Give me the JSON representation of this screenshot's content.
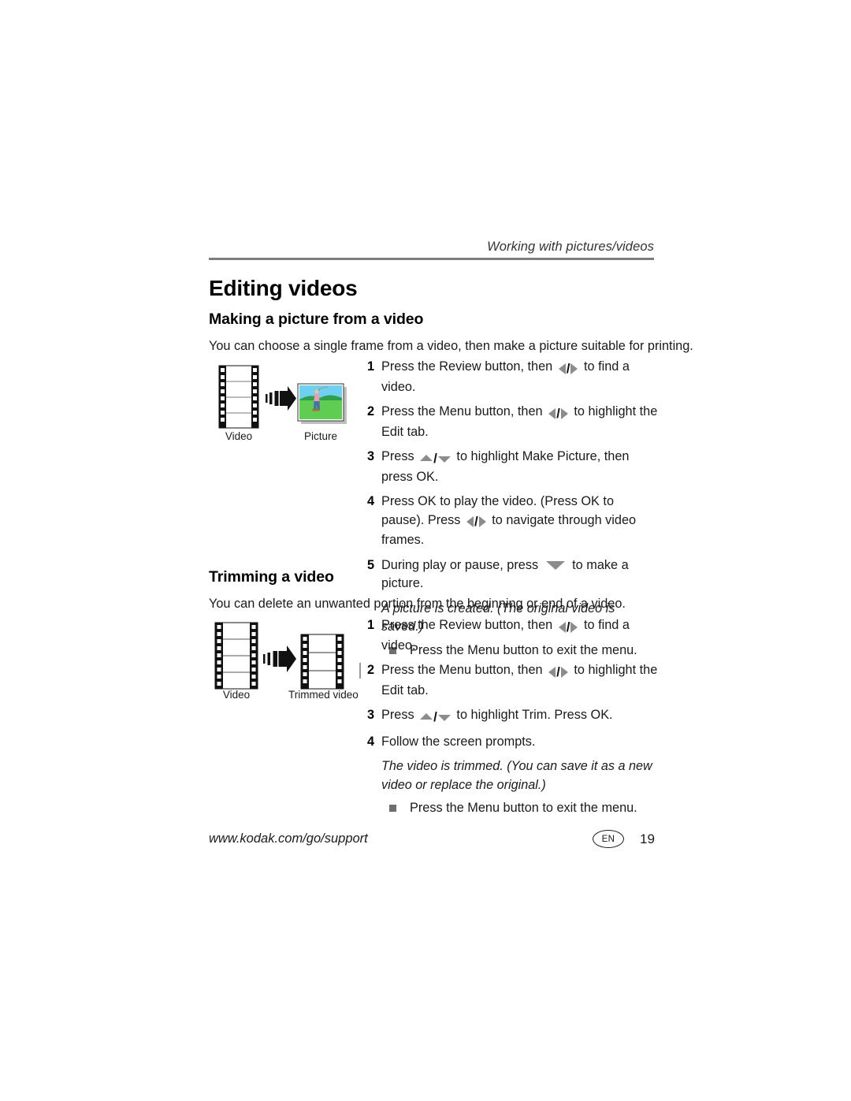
{
  "header": {
    "running_head": "Working with pictures/videos"
  },
  "headings": {
    "h1": "Editing videos",
    "section1": "Making a picture from a video",
    "section2": "Trimming a video"
  },
  "intro": {
    "section1": "You can choose a single frame from a video, then make a picture suitable for printing.",
    "section2": "You can delete an unwanted portion from the beginning or end of a video."
  },
  "section1_steps": [
    {
      "num": "1",
      "parts": [
        {
          "t": "text",
          "v": "Press the Review button, then "
        },
        {
          "t": "icon",
          "v": "left-right-arrows-icon"
        },
        {
          "t": "text",
          "v": " to find a video."
        }
      ]
    },
    {
      "num": "2",
      "parts": [
        {
          "t": "text",
          "v": "Press the Menu button, then "
        },
        {
          "t": "icon",
          "v": "left-right-arrows-icon"
        },
        {
          "t": "text",
          "v": " to highlight the Edit tab."
        }
      ]
    },
    {
      "num": "3",
      "parts": [
        {
          "t": "text",
          "v": "Press "
        },
        {
          "t": "icon",
          "v": "up-down-arrows-icon"
        },
        {
          "t": "text",
          "v": " to highlight Make Picture, then press OK."
        }
      ]
    },
    {
      "num": "4",
      "parts": [
        {
          "t": "text",
          "v": "Press OK to play the video. (Press OK to pause). Press "
        },
        {
          "t": "icon",
          "v": "left-right-arrows-icon"
        },
        {
          "t": "text",
          "v": " to navigate through video frames."
        }
      ]
    },
    {
      "num": "5",
      "parts": [
        {
          "t": "text",
          "v": "During play or pause, press "
        },
        {
          "t": "icon",
          "v": "down-arrow-icon"
        },
        {
          "t": "text",
          "v": " to make a picture."
        }
      ]
    }
  ],
  "section1_note": "A picture is created. (The original video is saved.)",
  "section1_bullet": "Press the Menu button to exit the menu.",
  "section2_steps": [
    {
      "num": "1",
      "parts": [
        {
          "t": "text",
          "v": "Press the Review button, then "
        },
        {
          "t": "icon",
          "v": "left-right-arrows-icon"
        },
        {
          "t": "text",
          "v": " to find a video."
        }
      ]
    },
    {
      "num": "2",
      "parts": [
        {
          "t": "text",
          "v": "Press the Menu button, then "
        },
        {
          "t": "icon",
          "v": "left-right-arrows-icon"
        },
        {
          "t": "text",
          "v": " to highlight the Edit tab."
        }
      ]
    },
    {
      "num": "3",
      "parts": [
        {
          "t": "text",
          "v": "Press "
        },
        {
          "t": "icon",
          "v": "up-down-arrows-icon"
        },
        {
          "t": "text",
          "v": " to highlight Trim. Press OK."
        }
      ]
    },
    {
      "num": "4",
      "parts": [
        {
          "t": "text",
          "v": "Follow the screen prompts."
        }
      ]
    }
  ],
  "section2_note": "The video is trimmed. (You can save it as a new video or replace the original.)",
  "section2_bullet": "Press the Menu button to exit the menu.",
  "figure1": {
    "left_caption": "Video",
    "right_caption": "Picture",
    "arrow": "motion-arrow-icon"
  },
  "figure2": {
    "left_caption": "Video",
    "right_caption": "Trimmed video",
    "arrow": "motion-arrow-icon"
  },
  "footer": {
    "url": "www.kodak.com/go/support",
    "language_badge": "EN",
    "page_number": "19"
  },
  "colors": {
    "rule": "#7d7d7d",
    "bullet": "#6e6e6e",
    "arrow_glyph": "#8c8c8c",
    "text": "#1a1a1a"
  }
}
